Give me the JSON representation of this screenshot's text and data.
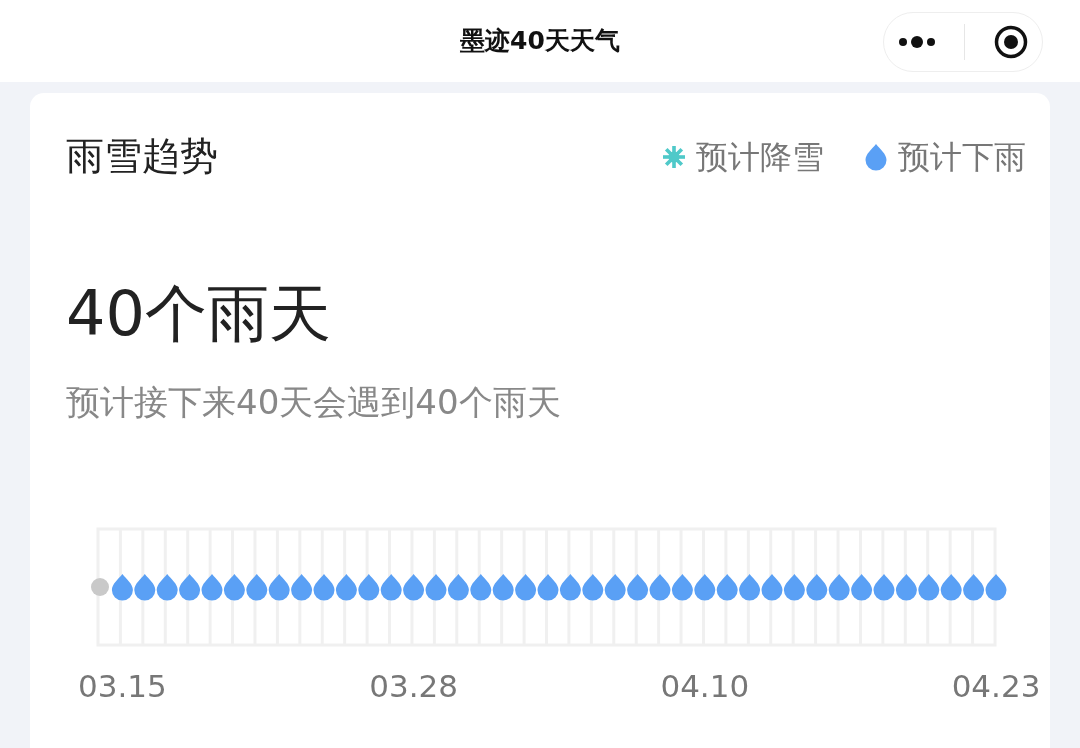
{
  "window": {
    "title": "墨迹40天天气"
  },
  "card": {
    "title": "雨雪趋势",
    "legend": [
      {
        "kind": "snow",
        "label": "预计降雪"
      },
      {
        "kind": "rain",
        "label": "预计下雨"
      }
    ],
    "headline": "40个雨天",
    "summary": "预计接下来40天会遇到40个雨天",
    "days": [
      {
        "kind": "none"
      },
      {
        "kind": "rain"
      },
      {
        "kind": "rain"
      },
      {
        "kind": "rain"
      },
      {
        "kind": "rain"
      },
      {
        "kind": "rain"
      },
      {
        "kind": "rain"
      },
      {
        "kind": "rain"
      },
      {
        "kind": "rain"
      },
      {
        "kind": "rain"
      },
      {
        "kind": "rain"
      },
      {
        "kind": "rain"
      },
      {
        "kind": "rain"
      },
      {
        "kind": "rain"
      },
      {
        "kind": "rain"
      },
      {
        "kind": "rain"
      },
      {
        "kind": "rain"
      },
      {
        "kind": "rain"
      },
      {
        "kind": "rain"
      },
      {
        "kind": "rain"
      },
      {
        "kind": "rain"
      },
      {
        "kind": "rain"
      },
      {
        "kind": "rain"
      },
      {
        "kind": "rain"
      },
      {
        "kind": "rain"
      },
      {
        "kind": "rain"
      },
      {
        "kind": "rain"
      },
      {
        "kind": "rain"
      },
      {
        "kind": "rain"
      },
      {
        "kind": "rain"
      },
      {
        "kind": "rain"
      },
      {
        "kind": "rain"
      },
      {
        "kind": "rain"
      },
      {
        "kind": "rain"
      },
      {
        "kind": "rain"
      },
      {
        "kind": "rain"
      },
      {
        "kind": "rain"
      },
      {
        "kind": "rain"
      },
      {
        "kind": "rain"
      },
      {
        "kind": "rain"
      },
      {
        "kind": "rain"
      }
    ],
    "date_labels": [
      "03.15",
      "03.28",
      "04.10",
      "04.23"
    ]
  }
}
